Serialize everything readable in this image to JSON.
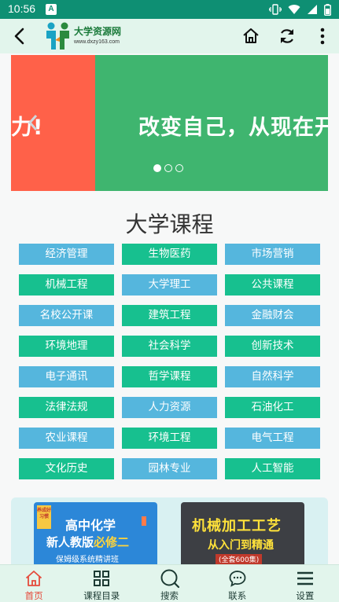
{
  "status_bar": {
    "time": "10:56",
    "app_icon_letter": "A"
  },
  "header": {
    "logo_title": "大学资源网",
    "logo_url": "www.dxzy163.com",
    "icons": [
      "back-icon",
      "home-icon",
      "refresh-icon",
      "more-icon"
    ]
  },
  "banner": {
    "left_slide_text": "力!",
    "slide_text": "改变自己，从现在开",
    "dot_count": 3,
    "active_dot": 0,
    "colors": {
      "left": "#ff6149",
      "main": "#3fb56f"
    }
  },
  "section": {
    "title": "大学课程"
  },
  "courses": [
    {
      "label": "经济管理",
      "color": "blue"
    },
    {
      "label": "生物医药",
      "color": "green"
    },
    {
      "label": "市场营销",
      "color": "blue"
    },
    {
      "label": "机械工程",
      "color": "green"
    },
    {
      "label": "大学理工",
      "color": "blue"
    },
    {
      "label": "公共课程",
      "color": "green"
    },
    {
      "label": "名校公开课",
      "color": "blue"
    },
    {
      "label": "建筑工程",
      "color": "green"
    },
    {
      "label": "金融财会",
      "color": "blue"
    },
    {
      "label": "环境地理",
      "color": "green"
    },
    {
      "label": "社会科学",
      "color": "green"
    },
    {
      "label": "创新技术",
      "color": "green"
    },
    {
      "label": "电子通讯",
      "color": "blue"
    },
    {
      "label": "哲学课程",
      "color": "green"
    },
    {
      "label": "自然科学",
      "color": "blue"
    },
    {
      "label": "法律法规",
      "color": "green"
    },
    {
      "label": "人力资源",
      "color": "blue"
    },
    {
      "label": "石油化工",
      "color": "green"
    },
    {
      "label": "农业课程",
      "color": "blue"
    },
    {
      "label": "环境工程",
      "color": "green"
    },
    {
      "label": "电气工程",
      "color": "blue"
    },
    {
      "label": "文化历史",
      "color": "green"
    },
    {
      "label": "园林专业",
      "color": "blue"
    },
    {
      "label": "人工智能",
      "color": "green"
    }
  ],
  "promos": [
    {
      "tag": "养成好习惯",
      "line1": "高中化学",
      "line2a": "新人教版",
      "line2b": "必修二",
      "line3": "保姆级系统精讲班"
    },
    {
      "line1": "机械加工工艺",
      "line2": "从入门到精通",
      "line3": "(全套600集)"
    }
  ],
  "bottom_nav": [
    {
      "label": "首页",
      "icon": "home-icon",
      "active": true
    },
    {
      "label": "课程目录",
      "icon": "grid-icon",
      "active": false
    },
    {
      "label": "搜索",
      "icon": "search-icon",
      "active": false
    },
    {
      "label": "联系",
      "icon": "chat-icon",
      "active": false
    },
    {
      "label": "设置",
      "icon": "menu-icon",
      "active": false
    }
  ],
  "colors": {
    "status_bar": "#0e8f73",
    "header_bg": "#e2f5ec",
    "chip_blue": "#55b6dd",
    "chip_green": "#17c08f",
    "nav_active": "#e54b3c"
  }
}
